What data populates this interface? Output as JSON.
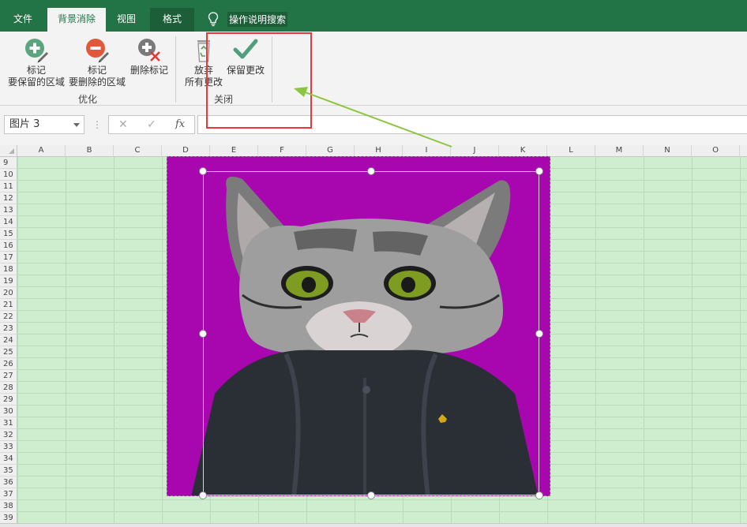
{
  "tabs": {
    "file": "文件",
    "background_removal": "背景消除",
    "view": "视图",
    "format": "格式"
  },
  "tell_me": "操作说明搜索",
  "ribbon": {
    "mark_keep": {
      "line1": "标记",
      "line2": "要保留的区域",
      "icon": "plus-circle-icon"
    },
    "mark_delete": {
      "line1": "标记",
      "line2": "要删除的区域",
      "icon": "minus-circle-icon"
    },
    "delete_mark": {
      "label": "删除标记",
      "icon": "delete-mark-icon"
    },
    "group_refine": "优化",
    "discard": {
      "line1": "放弃",
      "line2": "所有更改",
      "icon": "recycle-bin-icon"
    },
    "keep_changes": {
      "label": "保留更改",
      "icon": "checkmark-icon"
    },
    "group_close": "关闭"
  },
  "formula_bar": {
    "name_box": "图片 3",
    "fx": "fx",
    "formula": ""
  },
  "columns": [
    "A",
    "B",
    "C",
    "D",
    "E",
    "F",
    "G",
    "H",
    "I",
    "J",
    "K",
    "L",
    "M",
    "N",
    "O"
  ],
  "rows": [
    "9",
    "10",
    "11",
    "12",
    "13",
    "14",
    "15",
    "16",
    "17",
    "18",
    "19",
    "20",
    "21",
    "22",
    "23",
    "24",
    "25",
    "26",
    "27",
    "28",
    "29",
    "30",
    "31",
    "32",
    "33",
    "34",
    "35",
    "36",
    "37",
    "38",
    "39"
  ],
  "colors": {
    "excel_green": "#227447",
    "removal_background": "#a807b0",
    "annotation_red": "#e5393a",
    "arrow_green": "#8cc63e",
    "cell_highlight": "#cfeecf"
  }
}
